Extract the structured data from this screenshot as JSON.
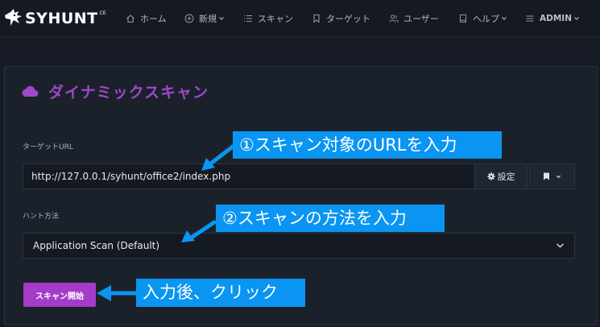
{
  "app": {
    "logo_text": "SYHUNT",
    "logo_sup": "CE"
  },
  "nav": {
    "items": [
      {
        "label": "ホーム",
        "icon": "home-icon"
      },
      {
        "label": "新規",
        "icon": "plus-circle-icon",
        "dropdown": true
      },
      {
        "label": "スキャン",
        "icon": "list-icon"
      },
      {
        "label": "ターゲット",
        "icon": "bookmark-icon"
      },
      {
        "label": "ユーザー",
        "icon": "users-icon"
      },
      {
        "label": "ヘルプ",
        "icon": "book-icon",
        "dropdown": true
      },
      {
        "label": "ADMIN",
        "icon": "menu-icon",
        "dropdown": true
      }
    ]
  },
  "card": {
    "title": "ダイナミックスキャン",
    "title_icon": "cloud-icon",
    "target_label": "ターゲットURL",
    "target_url": "http://127.0.0.1/syhunt/office2/index.php",
    "settings_label": "設定",
    "hunt_method_label": "ハント方法",
    "hunt_method_value": "Application Scan (Default)",
    "start_button": "スキャン開始"
  },
  "annotations": {
    "step1": "①スキャン対象のURLを入力",
    "step2": "②スキャンの方法を入力",
    "step3": "入力後、クリック"
  },
  "colors": {
    "accent": "#a43cc9",
    "title": "#9f48c9",
    "callout": "#0a95f2",
    "background": "#161b25"
  }
}
